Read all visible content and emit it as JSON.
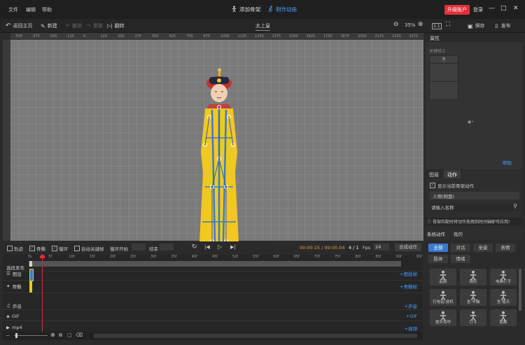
{
  "menu": [
    "文件",
    "编辑",
    "帮助"
  ],
  "window_tabs": [
    {
      "label": "添加骨架",
      "active": false
    },
    {
      "label": "制作动画",
      "active": true
    }
  ],
  "upgrade_label": "升级账户",
  "login_label": "登录",
  "toolbar": {
    "back": "返回主页",
    "new": "新建",
    "undo": "撤销",
    "redo": "重做",
    "flip": "翻转",
    "project_name": "太上皇",
    "zoom": "35%",
    "save": "保存",
    "publish": "发布"
  },
  "ruler_ticks": [
    "-500",
    "-375",
    "-250",
    "-125",
    "0",
    "125",
    "250",
    "375",
    "500",
    "625",
    "750",
    "875",
    "1000",
    "1125",
    "1250",
    "1375",
    "1500",
    "1625",
    "1750",
    "1875",
    "2000",
    "2125",
    "2250",
    "2375"
  ],
  "properties": {
    "title": "属性",
    "subtitle": "关键帧上",
    "col": "宽",
    "help": "帮助"
  },
  "layer_panel": {
    "tab_layers": "图层",
    "tab_actions": "动作",
    "show_current": "显示当前骨架动作",
    "select_value": "人物(侧面)",
    "search_placeholder": "请输入名称",
    "tip": "骨架匹配时将动作拖拽到时间轴即可应用!",
    "tab_system": "系统动作",
    "tab_mine": "我的"
  },
  "timeline_bar": {
    "track": "轨迹",
    "skeleton": "骨骼",
    "loop": "循环",
    "auto_keyframe": "自动关键帧",
    "loop_start": "循环开始",
    "end": "结束",
    "time": "00:00.15 / 00:00.04",
    "frame": "4 / 1",
    "fps_label": "Fps",
    "fps_value": "24",
    "compose": "合成动作"
  },
  "frame_ticks": [
    "0s",
    "5f",
    "10f",
    "15f",
    "20f",
    "25f",
    "30f",
    "35f",
    "40f",
    "45f",
    "50f",
    "55f",
    "60f",
    "65f",
    "70f",
    "75f",
    "80f",
    "85f",
    "90f",
    "95f"
  ],
  "tracks": [
    {
      "label": "选段发布",
      "icon": "",
      "add": ""
    },
    {
      "label": "图层",
      "icon": "layers-icon",
      "add": "+图层帧"
    },
    {
      "label": "骨骼",
      "icon": "bone-icon",
      "add": "+骨骼帧"
    },
    {
      "label": "声音",
      "icon": "sound-icon",
      "add": "+声音"
    },
    {
      "label": "GIF",
      "icon": "gif-icon",
      "add": "+GIF"
    },
    {
      "label": "mp4",
      "icon": "video-icon",
      "add": "+视频"
    }
  ],
  "categories": [
    "全部",
    "对话",
    "坐姿",
    "表情",
    "肢体",
    "情绪"
  ],
  "actions": [
    "起跳",
    "跳跃",
    "电脑打字",
    "打电话-提机",
    "坐-半鞠",
    "坐-摇天",
    "抱头惊呼",
    "打斗",
    "助推"
  ],
  "colors": {
    "accent": "#4a9eff",
    "danger": "#e0303a",
    "canvas": "#7a7a7a"
  }
}
